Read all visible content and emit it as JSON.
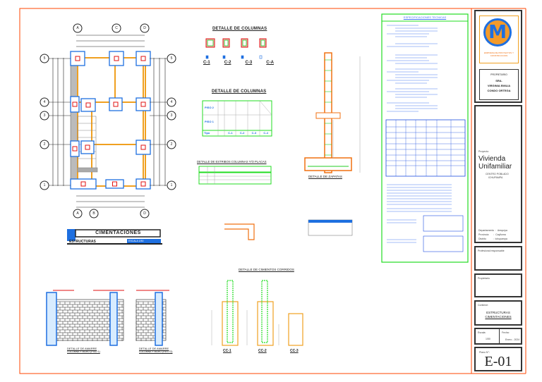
{
  "plan": {
    "axes_cols_top": [
      "A",
      "C",
      "D"
    ],
    "axes_cols_bottom": [
      "A",
      "B",
      "D"
    ],
    "axes_rows": [
      "5",
      "4",
      "3",
      "2",
      "1"
    ],
    "column_tags": [
      "C-1",
      "C-2",
      "C-3",
      "C-A"
    ]
  },
  "sheet_label": {
    "title": "CIMENTACIONES",
    "subtitle": "ESTRUCTURAS",
    "scale": "ESCALA 1/50"
  },
  "column_detail": {
    "title": "DETALLE DE COLUMNAS",
    "types": [
      "C-1",
      "C-2",
      "C-3",
      "C-A"
    ]
  },
  "column_table": {
    "title": "DETALLE DE COLUMNAS",
    "rows": [
      "PISO 2",
      "PISO 1"
    ],
    "footer_label": "Tipo",
    "types": [
      "C-1",
      "C-2",
      "C-3",
      "C-4"
    ]
  },
  "stirrups": {
    "title": "DETALLE DE ESTRIBOS COLUMNAS Y/O PLACAS"
  },
  "footing": {
    "title": "DETALLE DE ZAPATAS"
  },
  "running_foundations": {
    "title": "DETALLE DE CIMIENTOS CORRIDOS",
    "sections": [
      "CC-1",
      "CC-2",
      "CC-3"
    ]
  },
  "walls": {
    "detail1_title": "DETALLE DE AMARRE",
    "detail1_sub": "COLUMNA Y MURO (PISO 1)",
    "detail2_title": "DETALLE DE AMARRE",
    "detail2_sub": "COLUMNA Y MURO (RESTO)"
  },
  "specs": {
    "title": "ESPECIFICACIONES TECNICAS"
  },
  "title_block": {
    "logo_text": "EMPRESA DE PROYECTOS Y CONSTRUCCION",
    "owner_label": "PROPIETARIO",
    "owner_line1": "SRA.",
    "owner_line2": "VIRGINIA EMILIA",
    "owner_line3": "CONDO ORTEGA",
    "project_label": "Proyecto:",
    "project_line1": "Vivienda",
    "project_line2": "Unifamiliar",
    "location_line1": "CENTRO POBLADO",
    "location_line2": "ICHUPAMPA",
    "dept": "Departamento  :  Arequipa",
    "prov": "Provincia       :  Caylloma",
    "dist": "Distrito          :  Ichupampa",
    "professional_label": "Profesional responsable",
    "owner2_label": "Propietario",
    "contains_label": "Contiene:",
    "contains_line1": "ESTRUCTURAS",
    "contains_line2": "CIMENTACIONES",
    "scale_label": "Escala:",
    "scale_value": "1/50",
    "date_label": "Fecha:",
    "date_value": "Enero - 2024",
    "sheet_label": "Plano N°:",
    "sheet_number": "E-01"
  },
  "colors": {
    "frame": "#ff4500",
    "blue": "#1e6fe0",
    "green": "#22dd22",
    "orange": "#f0a020",
    "red": "#e01010"
  }
}
